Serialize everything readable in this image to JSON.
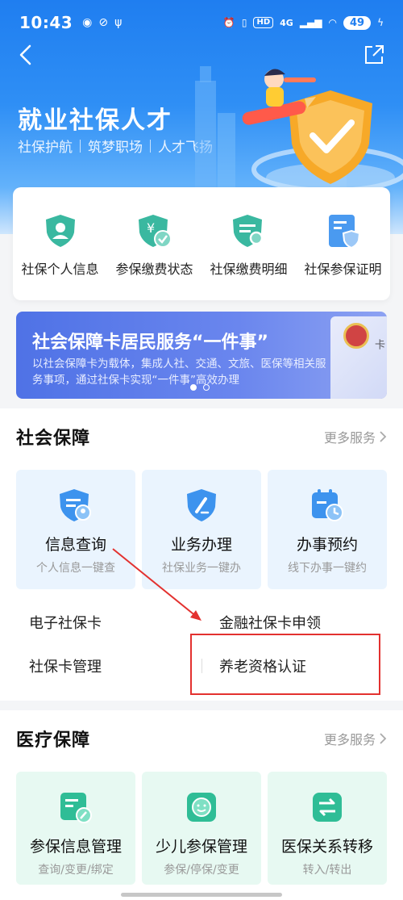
{
  "status": {
    "time": "10:43",
    "hd_badge": "HD",
    "signal_label": "4G",
    "battery": "49"
  },
  "hero": {
    "title": "就业社保人才",
    "tags": [
      "社保护航",
      "筑梦职场",
      "人才飞扬"
    ],
    "bg_color": "#1f7ef0"
  },
  "quick_actions": [
    {
      "label": "社保个人信息",
      "icon": "person-shield-icon"
    },
    {
      "label": "参保缴费状态",
      "icon": "yuan-check-icon"
    },
    {
      "label": "社保缴费明细",
      "icon": "search-shield-icon"
    },
    {
      "label": "社保参保证明",
      "icon": "certificate-shield-icon"
    }
  ],
  "banner": {
    "title": "社会保障卡居民服务“一件事”",
    "desc": "以社会保障卡为载体，集成人社、交通、文旅、医保等相关服务事项，通过社保卡实现“一件事”高效办理",
    "card_text": "社会保障卡",
    "page_count": 2,
    "active_page": 1
  },
  "social_section": {
    "title": "社会保障",
    "more": "更多服务",
    "tiles": [
      {
        "label": "信息查询",
        "sub": "个人信息一键查",
        "icon": "person-shield-icon"
      },
      {
        "label": "业务办理",
        "sub": "社保业务一键办",
        "icon": "pen-shield-icon"
      },
      {
        "label": "办事预约",
        "sub": "线下办事一键约",
        "icon": "calendar-clock-icon"
      }
    ],
    "links": [
      {
        "left": "电子社保卡",
        "right": "金融社保卡申领"
      },
      {
        "left": "社保卡管理",
        "right": "养老资格认证"
      }
    ]
  },
  "medical_section": {
    "title": "医疗保障",
    "more": "更多服务",
    "tiles": [
      {
        "label": "参保信息管理",
        "sub": "查询/变更/绑定",
        "icon": "edit-card-icon"
      },
      {
        "label": "少儿参保管理",
        "sub": "参保/停保/变更",
        "icon": "child-face-icon"
      },
      {
        "label": "医保关系转移",
        "sub": "转入/转出",
        "icon": "transfer-arrows-icon"
      }
    ]
  },
  "colors": {
    "accent": "#2a8cf4",
    "annotation_red": "#e3312f",
    "tile_blue": "#eaf4fe",
    "tile_green": "#e7f9f2"
  }
}
